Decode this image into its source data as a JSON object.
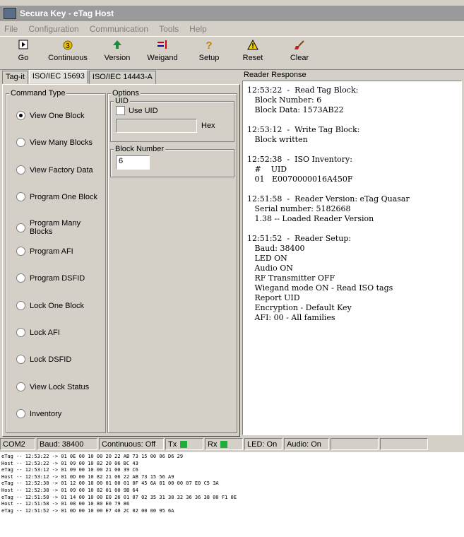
{
  "window": {
    "title": "Secura Key - eTag Host"
  },
  "menu": [
    "File",
    "Configuration",
    "Communication",
    "Tools",
    "Help"
  ],
  "toolbar": [
    {
      "label": "Go",
      "icon": "play-icon"
    },
    {
      "label": "Continuous",
      "icon": "continuous-icon"
    },
    {
      "label": "Version",
      "icon": "version-icon"
    },
    {
      "label": "Weigand",
      "icon": "weigand-icon"
    },
    {
      "label": "Setup",
      "icon": "help-icon"
    },
    {
      "label": "Reset",
      "icon": "warning-icon"
    },
    {
      "label": "Clear",
      "icon": "brush-icon"
    }
  ],
  "tabs": [
    "Tag-it",
    "ISO/IEC 15693",
    "ISO/IEC 14443-A"
  ],
  "command_type": {
    "label": "Command Type",
    "selected": "View One Block",
    "options": [
      "View One Block",
      "View Many Blocks",
      "View Factory Data",
      "Program One Block",
      "Program Many Blocks",
      "Program AFI",
      "Program DSFID",
      "Lock One Block",
      "Lock AFI",
      "Lock DSFID",
      "View Lock Status",
      "Inventory"
    ]
  },
  "options": {
    "label": "Options",
    "uid_label": "UID",
    "use_uid_label": "Use UID",
    "hex_label": "Hex",
    "block_number_label": "Block Number",
    "block_number_value": "6"
  },
  "reader_response": {
    "label": "Reader Response",
    "entries": [
      [
        "12:53:22  -  Read Tag Block:",
        "   Block Number: 6",
        "   Block Data: 1573AB22"
      ],
      [
        "12:53:12  -  Write Tag Block:",
        "   Block written"
      ],
      [
        "12:52:38  -  ISO Inventory:",
        "   #    UID",
        "   01   E0070000016A450F"
      ],
      [
        "12:51:58  -  Reader Version: eTag Quasar",
        "   Serial number: 5182668",
        "   1.38 -- Loaded Reader Version"
      ],
      [
        "12:51:52  -  Reader Setup:",
        "   Baud: 38400",
        "   LED ON",
        "   Audio ON",
        "   RF Transmitter OFF",
        "   Wiegand mode ON - Read ISO tags",
        "   Report UID",
        "   Encryption - Default Key",
        "   AFI: 00 - All families"
      ]
    ]
  },
  "status": {
    "port": "COM2",
    "baud": "Baud: 38400",
    "continuous": "Continuous: Off",
    "tx": "Tx",
    "rx": "Rx",
    "led": "LED: On",
    "audio": "Audio: On",
    "led_color": "#1fae3a"
  },
  "log": [
    "eTag -- 12:53:22 -> 01 0E 00 10 00 20 22 AB 73 15 00 06 D6 29",
    "Host -- 12:53:22 -> 01 09 00 10 82 20 06 BC 43",
    "eTag -- 12:53:12 -> 01 09 00 10 00 21 00 39 C6",
    "Host -- 12:53:12 -> 01 0D 00 10 82 21 06 22 AB 73 15 56 A9",
    "eTag -- 12:52:38 -> 01 12 00 10 00 01 00 01 0F 45 6A 01 00 00 07 E0 C5 3A",
    "Host -- 12:52:38 -> 01 09 00 10 82 01 00 9B 64",
    "eTag -- 12:51:58 -> 01 14 00 10 00 E0 26 01 07 02 35 31 38 32 36 36 38 00 F1 0E",
    "Host -- 12:51:58 -> 01 08 00 10 80 E0 79 86",
    "eTag -- 12:51:52 -> 01 0D 00 10 00 E7 40 2C 02 00 00 95 6A"
  ]
}
